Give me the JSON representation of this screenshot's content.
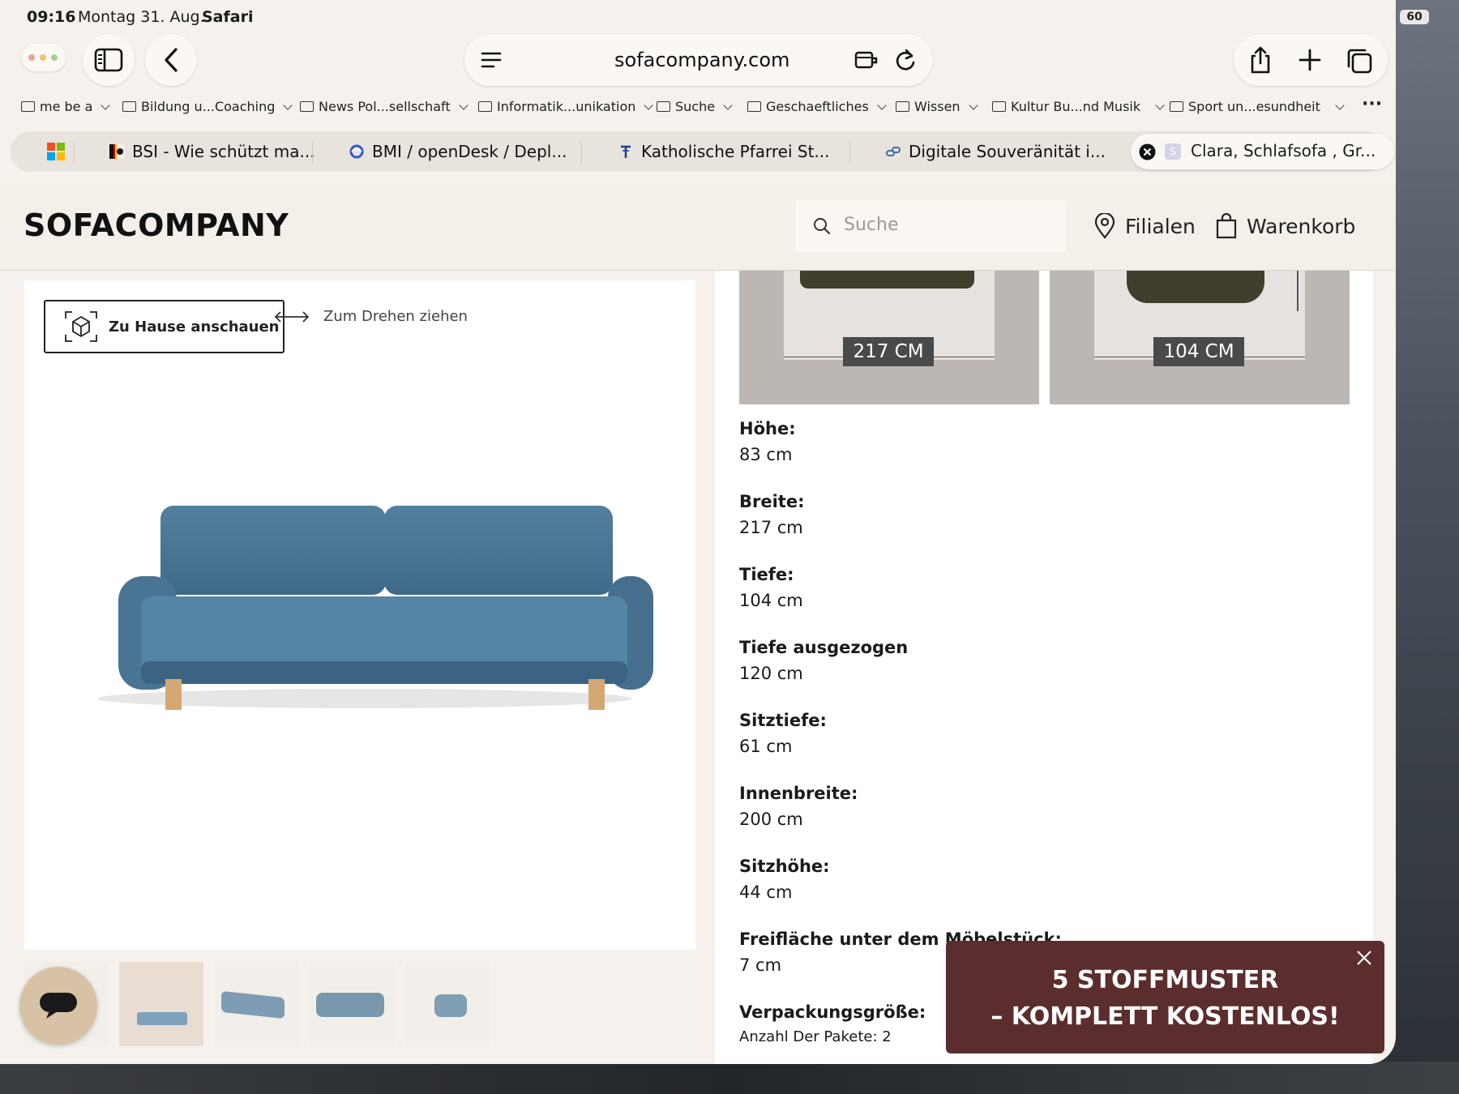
{
  "status": {
    "time": "09:16",
    "date": "Montag 31. Aug.",
    "app": "Safari",
    "battery": "60"
  },
  "browser": {
    "url": "sofacompany.com",
    "bookmarks": [
      {
        "label": "me be a"
      },
      {
        "label": "Bildung u...Coaching"
      },
      {
        "label": "News Pol...sellschaft"
      },
      {
        "label": "Informatik...unikation"
      },
      {
        "label": "Suche"
      },
      {
        "label": "Geschaeftliches"
      },
      {
        "label": "Wissen"
      },
      {
        "label": "Kultur Bu...nd Musik"
      },
      {
        "label": "Sport un...esundheit"
      }
    ],
    "tabs": [
      {
        "label": "BSI - Wie schützt ma..."
      },
      {
        "label": "BMI / openDesk / Depl..."
      },
      {
        "label": "Katholische Pfarrei St..."
      },
      {
        "label": "Digitale Souveränität i..."
      },
      {
        "label": "Clara, Schlafsofa , Gr..."
      }
    ]
  },
  "site": {
    "logo": "SOFACOMPANY",
    "search_placeholder": "Suche",
    "nav": {
      "stores": "Filialen",
      "cart": "Warenkorb"
    }
  },
  "gallery": {
    "ar_button": "Zu Hause anschauen",
    "rotate_hint": "Zum Drehen ziehen",
    "sofa_color": "#4a7493"
  },
  "dimensions": {
    "width_label": "217 CM",
    "depth_label": "104 CM"
  },
  "specs": [
    {
      "key": "Höhe:",
      "value": "83 cm"
    },
    {
      "key": "Breite:",
      "value": "217 cm"
    },
    {
      "key": "Tiefe:",
      "value": "104 cm"
    },
    {
      "key": "Tiefe ausgezogen",
      "value": "120 cm"
    },
    {
      "key": "Sitztiefe:",
      "value": "61 cm"
    },
    {
      "key": "Innenbreite:",
      "value": "200 cm"
    },
    {
      "key": "Sitzhöhe:",
      "value": "44 cm"
    },
    {
      "key": "Freifläche unter dem Möbelstück:",
      "value": "7 cm"
    },
    {
      "key": "Verpackungsgröße:",
      "value": "Anzahl Der Pakete: 2"
    }
  ],
  "promo": {
    "line1": "5 STOFFMUSTER",
    "line2": "– KOMPLETT KOSTENLOS!",
    "bg": "#5c2d2e"
  }
}
